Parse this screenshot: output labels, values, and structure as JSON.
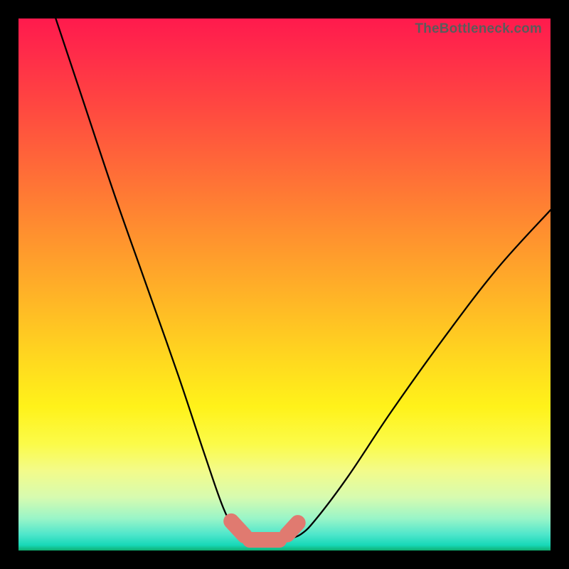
{
  "watermark": "TheBottleneck.com",
  "colors": {
    "background": "#000000",
    "curve": "#000000",
    "nub": "#e07a70"
  },
  "chart_data": {
    "type": "line",
    "title": "",
    "xlabel": "",
    "ylabel": "",
    "xlim": [
      0,
      100
    ],
    "ylim": [
      0,
      100
    ],
    "grid": false,
    "legend": false,
    "series": [
      {
        "name": "left-curve",
        "x": [
          7,
          12,
          18,
          24,
          30,
          35,
          38.5,
          41,
          43
        ],
        "y": [
          100,
          85,
          67,
          50,
          33,
          18,
          8,
          3.5,
          2
        ]
      },
      {
        "name": "right-curve",
        "x": [
          50,
          53,
          56,
          62,
          70,
          80,
          90,
          100
        ],
        "y": [
          2,
          3,
          6,
          14,
          26,
          40,
          53,
          64
        ]
      },
      {
        "name": "trough-left-nub",
        "x": [
          40,
          42.5
        ],
        "y": [
          5.5,
          2.8
        ]
      },
      {
        "name": "trough-bottom-nub",
        "x": [
          43.5,
          49
        ],
        "y": [
          2.0,
          2.0
        ]
      },
      {
        "name": "trough-right-nub",
        "x": [
          50.5,
          52.5
        ],
        "y": [
          3.0,
          5.2
        ]
      }
    ]
  }
}
